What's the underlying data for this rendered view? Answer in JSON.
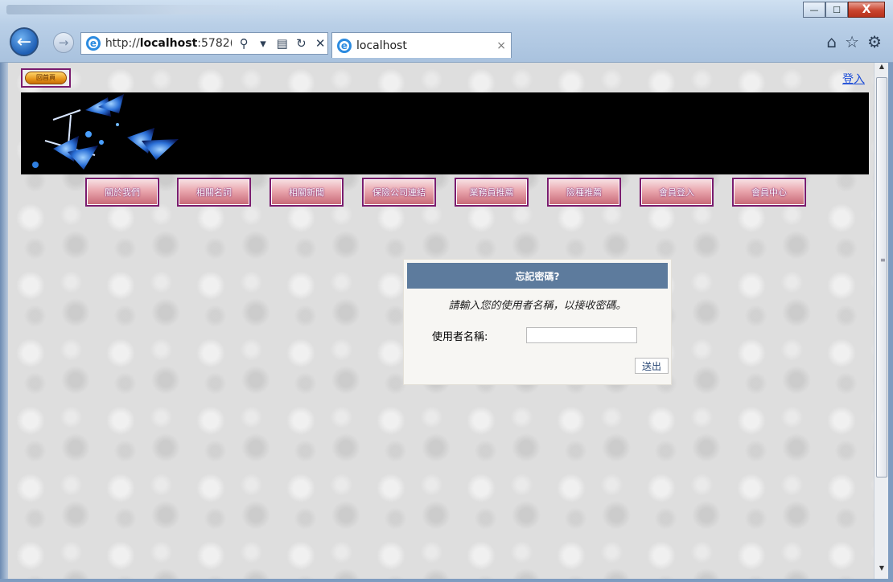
{
  "browser": {
    "url_prefix": "http://",
    "url_host": "localhost",
    "url_rest": ":5782(",
    "tab_title": "localhost",
    "tab_close": "×",
    "ie_glyph": "e",
    "window_buttons": {
      "minimize": "—",
      "maximize": "☐",
      "close": "X"
    }
  },
  "header": {
    "home_button_label": "回首頁",
    "login_link": "登入"
  },
  "nav": {
    "items": [
      "關於我們",
      "相關名詞",
      "相關新聞",
      "保險公司連結",
      "業務員推薦",
      "險種推薦",
      "會員登入",
      "會員中心"
    ]
  },
  "password_recovery": {
    "title": "忘記密碼?",
    "instruction": "請輸入您的使用者名稱，以接收密碼。",
    "username_label": "使用者名稱:",
    "username_value": "",
    "submit_label": "送出"
  },
  "colors": {
    "dialog_header": "#5d7b9d",
    "dialog_bg": "#f7f6f3",
    "nav_border": "#7a1b6e",
    "link": "#1a4bd6"
  },
  "icons": [
    "back-arrow-icon",
    "forward-arrow-icon",
    "internet-explorer-icon",
    "search-icon",
    "dropdown-icon",
    "compat-view-icon",
    "refresh-icon",
    "stop-icon",
    "home-icon",
    "favorites-star-icon",
    "settings-gear-icon",
    "butterfly-banner-image"
  ]
}
